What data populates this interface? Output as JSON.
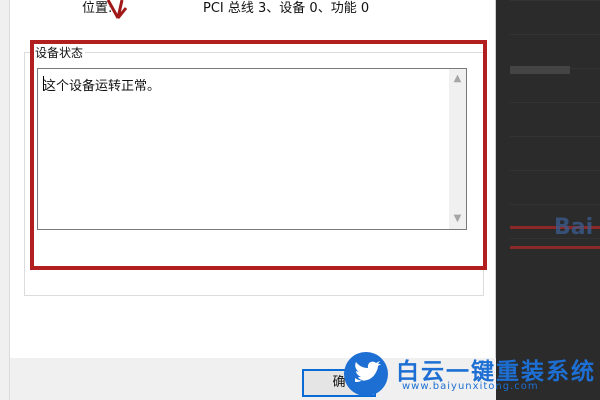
{
  "properties": {
    "location_label": "位置:",
    "location_value": "PCI 总线 3、设备 0、功能 0"
  },
  "device_status": {
    "group_label": "设备状态",
    "text": "这个设备运转正常。"
  },
  "footer": {
    "ok_label": "确"
  },
  "watermark": {
    "title": "白云一键重装系统",
    "url": "www.baiyunxitong.com"
  },
  "background_window": {
    "fragment_text": "Bai"
  },
  "colors": {
    "highlight_red": "#b21f1f",
    "accent_blue": "#1d6fd3",
    "button_focus": "#0a6ad6"
  }
}
